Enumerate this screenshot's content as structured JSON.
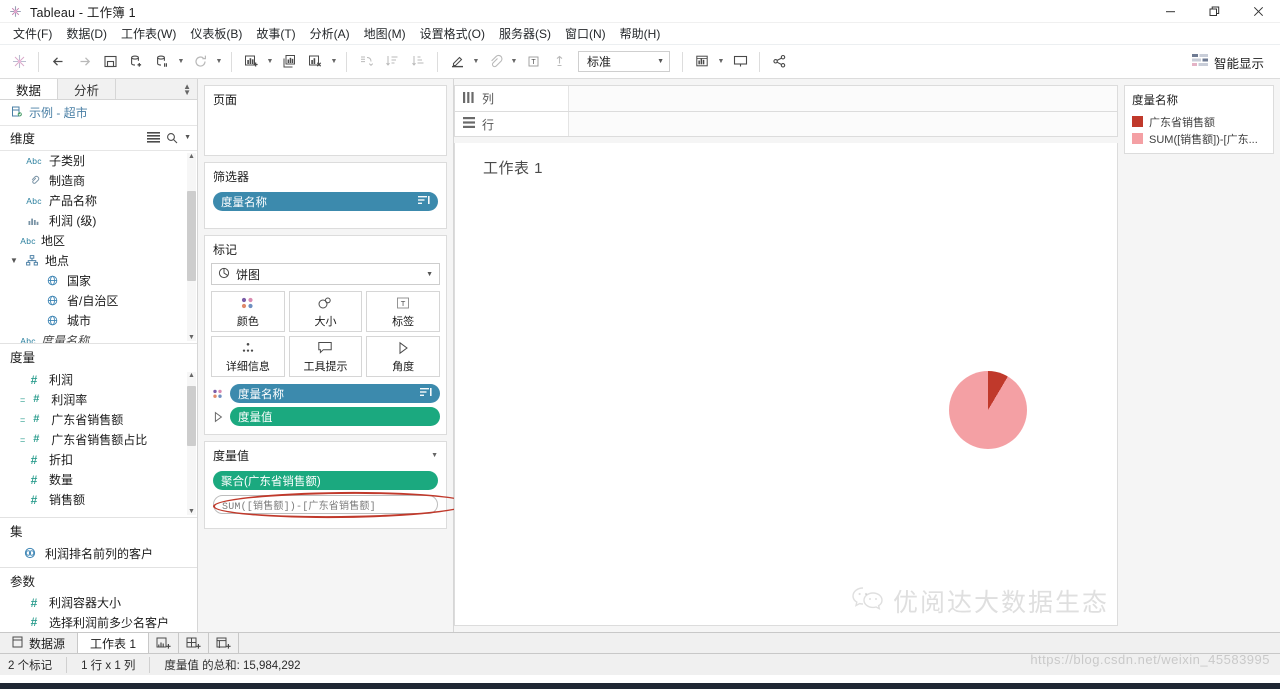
{
  "window": {
    "title": "Tableau - 工作簿 1",
    "logo_icon": "tableau-logo-icon",
    "controls": [
      {
        "name": "minimize-button",
        "glyph": "—"
      },
      {
        "name": "restore-button",
        "glyph": "❐"
      },
      {
        "name": "close-button",
        "glyph": "✕"
      }
    ]
  },
  "menubar": {
    "items": [
      {
        "label": "文件(F)",
        "name": "menu-file"
      },
      {
        "label": "数据(D)",
        "name": "menu-data"
      },
      {
        "label": "工作表(W)",
        "name": "menu-worksheet"
      },
      {
        "label": "仪表板(B)",
        "name": "menu-dashboard"
      },
      {
        "label": "故事(T)",
        "name": "menu-story"
      },
      {
        "label": "分析(A)",
        "name": "menu-analysis"
      },
      {
        "label": "地图(M)",
        "name": "menu-map"
      },
      {
        "label": "设置格式(O)",
        "name": "menu-format"
      },
      {
        "label": "服务器(S)",
        "name": "menu-server"
      },
      {
        "label": "窗口(N)",
        "name": "menu-window"
      },
      {
        "label": "帮助(H)",
        "name": "menu-help"
      }
    ]
  },
  "toolbar": {
    "fit_value": "标准",
    "showme_label": "智能显示",
    "showme_icon": "show-me-icon",
    "buttons": [
      "tableau-home-icon",
      "back-icon",
      "forward-icon",
      "save-icon",
      "new-data-source-icon",
      "pause-refresh-icon",
      "refresh-icon",
      "new-worksheet-icon",
      "duplicate-sheet-icon",
      "clear-sheet-icon",
      "swap-rows-columns-icon",
      "sort-ascending-icon",
      "sort-descending-icon",
      "highlighter-icon",
      "fixed-axis-icon",
      "labels-icon",
      "annotation-icon",
      "presentation-icon",
      "share-icon"
    ]
  },
  "datapane": {
    "tabs": [
      {
        "label": "数据",
        "name": "tab-data",
        "active": true
      },
      {
        "label": "分析",
        "name": "tab-analytics",
        "active": false
      }
    ],
    "datasource": {
      "label": "示例 - 超市",
      "icon": "datasource-icon"
    },
    "dimensions": {
      "header": "维度",
      "view_icon": "view-data-icon",
      "search_icon": "search-icon",
      "menu_icon": "chevron-down-icon",
      "fields": [
        {
          "label": "子类别",
          "icon": "abc",
          "indent": 0
        },
        {
          "label": "制造商",
          "icon": "link",
          "indent": 0
        },
        {
          "label": "产品名称",
          "icon": "abc",
          "indent": 0
        },
        {
          "label": "利润 (级)",
          "icon": "bin",
          "indent": 0
        },
        {
          "label": "地区",
          "icon": "abc",
          "indent": 0
        },
        {
          "label": "地点",
          "icon": "hierarchy",
          "indent": 0,
          "group": true,
          "expanded": true
        },
        {
          "label": "国家",
          "icon": "geo",
          "indent": 1
        },
        {
          "label": "省/自治区",
          "icon": "geo",
          "indent": 1
        },
        {
          "label": "城市",
          "icon": "geo",
          "indent": 1
        },
        {
          "label": "度量名称",
          "icon": "abc",
          "indent": 0,
          "italic": true
        }
      ]
    },
    "measures": {
      "header": "度量",
      "fields": [
        {
          "label": "利润",
          "icon": "hash"
        },
        {
          "label": "利润率",
          "icon": "hash-calc"
        },
        {
          "label": "广东省销售额",
          "icon": "hash-calc"
        },
        {
          "label": "广东省销售额占比",
          "icon": "hash-calc"
        },
        {
          "label": "折扣",
          "icon": "hash"
        },
        {
          "label": "数量",
          "icon": "hash"
        },
        {
          "label": "销售额",
          "icon": "hash"
        }
      ]
    },
    "sets": {
      "header": "集",
      "fields": [
        {
          "label": "利润排名前列的客户",
          "icon": "set"
        }
      ]
    },
    "parameters": {
      "header": "参数",
      "fields": [
        {
          "label": "利润容器大小",
          "icon": "hash"
        },
        {
          "label": "选择利润前多少名客户",
          "icon": "hash"
        }
      ]
    }
  },
  "shelves": {
    "pages": {
      "title": "页面",
      "pills": []
    },
    "filters": {
      "title": "筛选器",
      "pills": [
        {
          "label": "度量名称",
          "color": "blue",
          "end_icon": "filter-pill-icon"
        }
      ]
    },
    "marks": {
      "title": "标记",
      "type_value": "饼图",
      "type_icon": "pie-mark-icon",
      "buttons": [
        {
          "label": "颜色",
          "name": "marks-color-button",
          "icon": "color-icon"
        },
        {
          "label": "大小",
          "name": "marks-size-button",
          "icon": "size-icon"
        },
        {
          "label": "标签",
          "name": "marks-label-button",
          "icon": "label-icon"
        },
        {
          "label": "详细信息",
          "name": "marks-detail-button",
          "icon": "detail-icon"
        },
        {
          "label": "工具提示",
          "name": "marks-tooltip-button",
          "icon": "tooltip-icon"
        },
        {
          "label": "角度",
          "name": "marks-angle-button",
          "icon": "angle-icon"
        }
      ],
      "pills": [
        {
          "label": "度量名称",
          "color": "blue",
          "handle": "color-icon",
          "end_icon": "sort-pill-icon"
        },
        {
          "label": "度量值",
          "color": "green",
          "handle": "angle-icon"
        }
      ]
    },
    "measure_values": {
      "title": "度量值",
      "menu_icon": "chevron-down-icon",
      "pills": [
        {
          "label": "聚合(广东省销售额)",
          "style": "green"
        },
        {
          "label": "SUM([销售额])-[广东省销售额]",
          "style": "white",
          "annotated": true
        }
      ],
      "annotation": {
        "shape": "ellipse",
        "color": "#c0392b"
      }
    },
    "columns": {
      "label": "列",
      "icon": "columns-icon",
      "pills": []
    },
    "rows": {
      "label": "行",
      "icon": "rows-icon",
      "pills": []
    }
  },
  "canvas": {
    "worksheet_title": "工作表 1",
    "watermark": "优阅达大数据生态",
    "watermark_icon": "wechat-icon",
    "watermark_url": "https://blog.csdn.net/weixin_45583995"
  },
  "chart_data": {
    "type": "pie",
    "title": "工作表 1",
    "labels": [
      "广东省销售额",
      "SUM([销售额])-[广东省销售额]"
    ],
    "values": [
      8.5,
      91.5
    ],
    "colors": [
      "#c0392b",
      "#f4a0a4"
    ],
    "total_label": "度量值 的总和: 15,984,292",
    "legend_position": "right",
    "grid": false
  },
  "legend": {
    "title": "度量名称",
    "entries": [
      {
        "label": "广东省销售额",
        "color": "#c0392b"
      },
      {
        "label": "SUM([销售额])-[广东...",
        "color": "#f4a0a4"
      }
    ]
  },
  "sheetbar": {
    "datasource_label": "数据源",
    "datasource_icon": "datasource-tab-icon",
    "tabs": [
      {
        "label": "工作表 1",
        "name": "sheet-tab-1",
        "active": true
      }
    ],
    "new_buttons": [
      {
        "name": "new-worksheet-button",
        "icon": "new-worksheet-icon"
      },
      {
        "name": "new-dashboard-button",
        "icon": "new-dashboard-icon"
      },
      {
        "name": "new-story-button",
        "icon": "new-story-icon"
      }
    ]
  },
  "statusbar": {
    "marks": "2 个标记",
    "dims": "1 行 x 1 列",
    "summary": "度量值 的总和: 15,984,292"
  }
}
